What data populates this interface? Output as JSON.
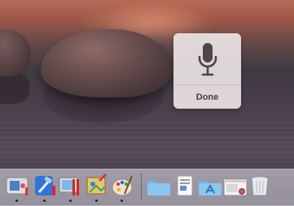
{
  "dictation": {
    "done_label": "Done",
    "mic_icon": "microphone-icon",
    "accent_color": "#4c4549"
  },
  "dock": {
    "apps": [
      {
        "icon": "system-preferences-icon",
        "running": true
      },
      {
        "icon": "xcode-icon",
        "running": true
      },
      {
        "icon": "preview-icon",
        "running": true
      },
      {
        "icon": "photo-editor-icon",
        "running": true
      },
      {
        "icon": "paint-palette-icon",
        "running": true
      }
    ],
    "folders": [
      {
        "icon": "folder-icon"
      },
      {
        "icon": "documents-stack-icon"
      },
      {
        "icon": "applications-folder-icon"
      },
      {
        "icon": "browser-window-icon"
      },
      {
        "icon": "trash-icon"
      }
    ]
  }
}
